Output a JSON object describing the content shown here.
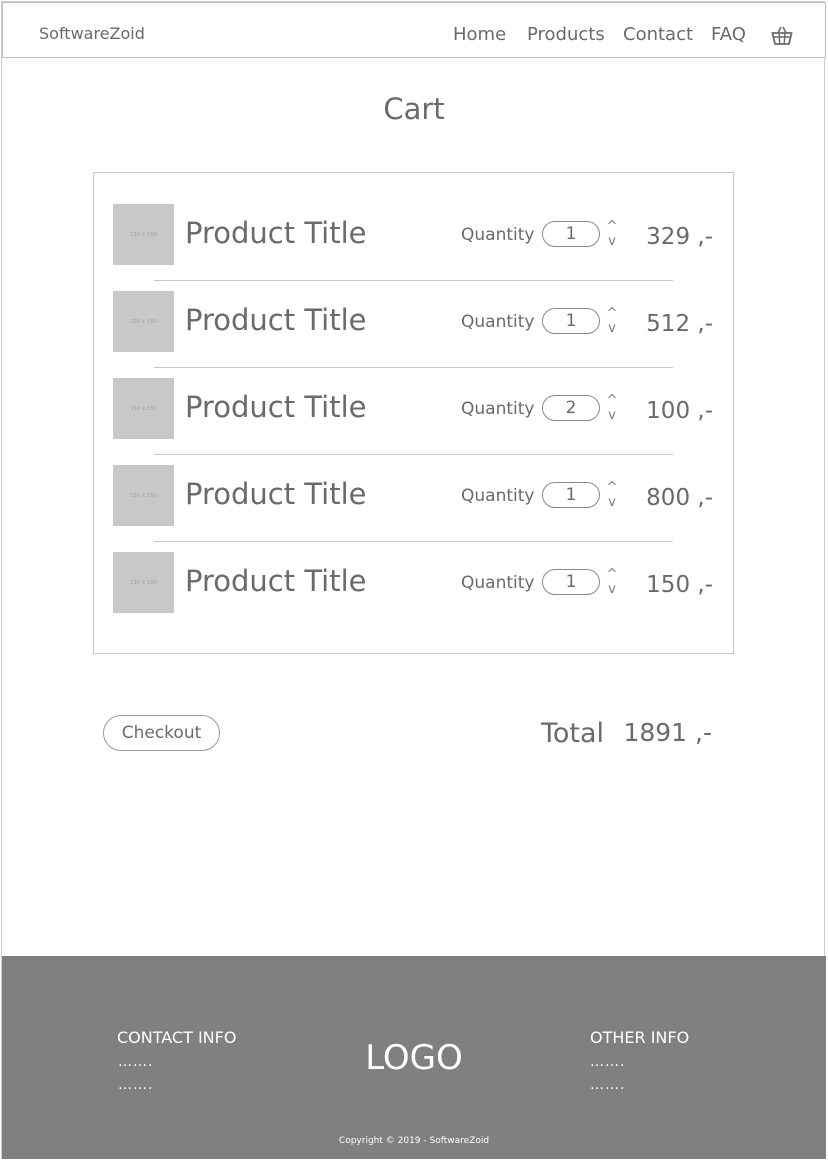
{
  "header": {
    "brand": "SoftwareZoid",
    "nav": [
      "Home",
      "Products",
      "Contact",
      "FAQ"
    ],
    "cart_icon": "basket-icon"
  },
  "page": {
    "title": "Cart"
  },
  "cart": {
    "quantity_label": "Quantity",
    "thumbnail_text": "150 × 150",
    "items": [
      {
        "title": "Product Title",
        "quantity": "1",
        "price": "329 ,-"
      },
      {
        "title": "Product Title",
        "quantity": "1",
        "price": "512 ,-"
      },
      {
        "title": "Product Title",
        "quantity": "2",
        "price": "100 ,-"
      },
      {
        "title": "Product Title",
        "quantity": "1",
        "price": "800 ,-"
      },
      {
        "title": "Product Title",
        "quantity": "1",
        "price": "150 ,-"
      }
    ],
    "step_up": "^",
    "step_down": "v"
  },
  "summary": {
    "checkout_label": "Checkout",
    "total_label": "Total",
    "total_value": "1891 ,-"
  },
  "footer": {
    "contact_heading": "CONTACT INFO",
    "contact_lines": [
      "…….",
      "……."
    ],
    "logo": "LOGO",
    "other_heading": "OTHER INFO",
    "other_lines": [
      "…….",
      "……."
    ],
    "copyright": "Copyright © 2019 - SoftwareZoid"
  },
  "colors": {
    "text": "#6a6a6a",
    "placeholder": "#c8c8c8",
    "footer_bg": "#808080"
  }
}
